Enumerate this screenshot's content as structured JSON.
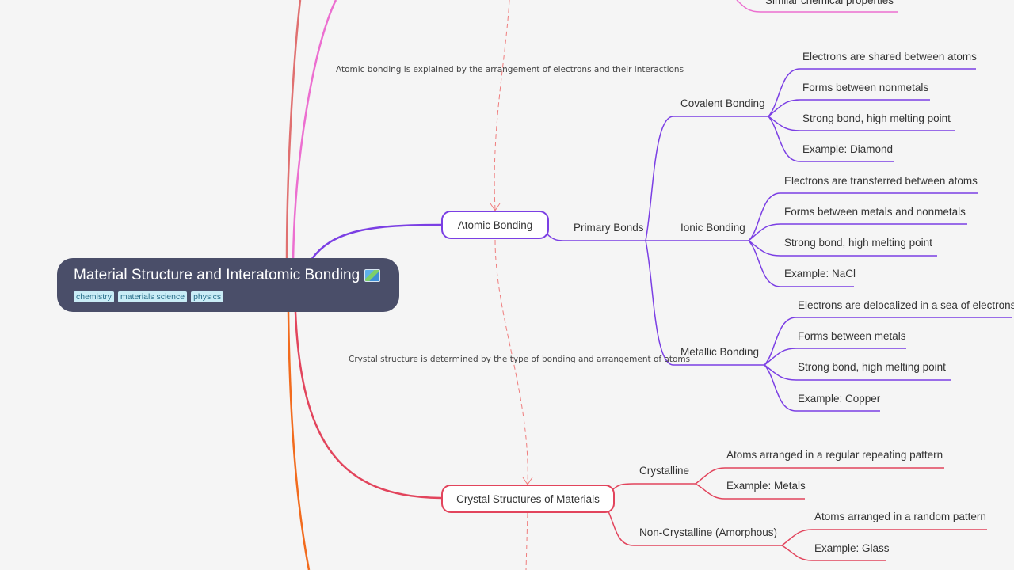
{
  "root": {
    "title": "Material Structure and Interatomic Bonding",
    "icon": "world-map-icon",
    "tags": [
      "chemistry",
      "materials science",
      "physics"
    ]
  },
  "colors": {
    "background": "#f5f5f5",
    "root_fill": "#4a4e69",
    "branch_salmon": "#e07070",
    "branch_pink": "#ec6fd0",
    "branch_purple": "#7b3fe4",
    "branch_red": "#e2445c",
    "branch_orange": "#f26b1d",
    "relationship_dashed": "#ef7d7d",
    "tag_fill": "#c9ecf6"
  },
  "top_partial": {
    "label": "Similar chemical properties"
  },
  "relationships": [
    {
      "label": "Atomic bonding is explained by the arrangement of electrons and their interactions"
    },
    {
      "label": "Crystal structure is determined by the type of bonding and arrangement of atoms"
    }
  ],
  "atomic_bonding": {
    "label": "Atomic Bonding",
    "primary": {
      "label": "Primary Bonds",
      "types": [
        {
          "label": "Covalent Bonding",
          "items": [
            "Electrons are shared between atoms",
            "Forms between nonmetals",
            "Strong bond, high melting point",
            "Example: Diamond"
          ]
        },
        {
          "label": "Ionic Bonding",
          "items": [
            "Electrons are transferred between atoms",
            "Forms between metals and nonmetals",
            "Strong bond, high melting point",
            "Example: NaCl"
          ]
        },
        {
          "label": "Metallic Bonding",
          "items": [
            "Electrons are delocalized in a sea of electrons",
            "Forms between metals",
            "Strong bond, high melting point",
            "Example: Copper"
          ]
        }
      ]
    }
  },
  "crystal_structures": {
    "label": "Crystal Structures of Materials",
    "types": [
      {
        "label": "Crystalline",
        "items": [
          "Atoms arranged in a regular repeating pattern",
          "Example: Metals"
        ]
      },
      {
        "label": "Non-Crystalline (Amorphous)",
        "items": [
          "Atoms arranged in a random pattern",
          "Example: Glass"
        ]
      }
    ]
  }
}
